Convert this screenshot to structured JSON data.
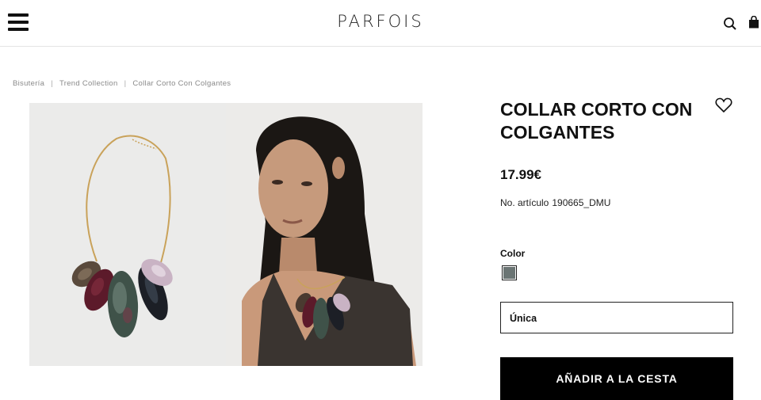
{
  "header": {
    "logo": "PARFOIS",
    "menu_icon": "hamburger-menu-icon",
    "search_icon": "search-icon",
    "bag_icon": "shopping-bag-icon"
  },
  "breadcrumb": {
    "items": [
      "Bisutería",
      "Trend Collection",
      "Collar Corto Con Colgantes"
    ],
    "separator": "|"
  },
  "product": {
    "title": "COLLAR CORTO CON COLGANTES",
    "price": "17.99€",
    "sku_label": "No. artículo",
    "sku_value": "190665_DMU",
    "color_label": "Color",
    "color_swatch": "#6b7574",
    "size_value": "Única",
    "add_to_cart": "AÑADIR A LA CESTA",
    "wishlist_icon": "heart-outline-icon"
  }
}
